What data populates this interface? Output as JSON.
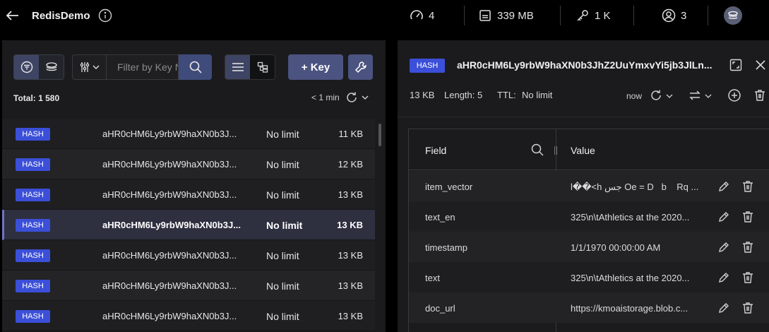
{
  "header": {
    "db_name": "RedisDemo",
    "stats": [
      {
        "icon": "gauge-icon",
        "value": "4"
      },
      {
        "icon": "memory-icon",
        "value": "339 MB"
      },
      {
        "icon": "key-icon",
        "value": "1 K"
      },
      {
        "icon": "user-icon",
        "value": "3"
      }
    ]
  },
  "browser": {
    "search_placeholder": "Filter by Key Name or Pattern",
    "add_key_label": "+ Key",
    "total": "Total: 1 580",
    "refresh_label": "< 1 min",
    "keys": [
      {
        "type": "HASH",
        "name": "aHR0cHM6Ly9rbW9haXN0b3J...",
        "ttl": "No limit",
        "size": "11 KB"
      },
      {
        "type": "HASH",
        "name": "aHR0cHM6Ly9rbW9haXN0b3J...",
        "ttl": "No limit",
        "size": "12 KB"
      },
      {
        "type": "HASH",
        "name": "aHR0cHM6Ly9rbW9haXN0b3J...",
        "ttl": "No limit",
        "size": "13 KB"
      },
      {
        "type": "HASH",
        "name": "aHR0cHM6Ly9rbW9haXN0b3J...",
        "ttl": "No limit",
        "size": "13 KB"
      },
      {
        "type": "HASH",
        "name": "aHR0cHM6Ly9rbW9haXN0b3J...",
        "ttl": "No limit",
        "size": "13 KB"
      },
      {
        "type": "HASH",
        "name": "aHR0cHM6Ly9rbW9haXN0b3J...",
        "ttl": "No limit",
        "size": "13 KB"
      },
      {
        "type": "HASH",
        "name": "aHR0cHM6Ly9rbW9haXN0b3J...",
        "ttl": "No limit",
        "size": "13 KB"
      }
    ]
  },
  "details": {
    "type": "HASH",
    "key_name": "aHR0cHM6Ly9rbW9haXN0b3JhZ2UuYmxvYi5jb3JlLn...",
    "size": "13 KB",
    "length": "Length: 5",
    "ttl_label": "TTL:",
    "ttl_value": "No limit",
    "refresh_label": "now",
    "columns": {
      "field": "Field",
      "value": "Value"
    },
    "rows": [
      {
        "field": "item_vector",
        "value": "l��<h جس Oe = D   b    Rq ..."
      },
      {
        "field": "text_en",
        "value": "325\\n\\tAthletics at the 2020..."
      },
      {
        "field": "timestamp",
        "value": "1/1/1970 00:00:00 AM"
      },
      {
        "field": "text",
        "value": "325\\n\\tAthletics at the 2020..."
      },
      {
        "field": "doc_url",
        "value": "https://kmoaistorage.blob.c..."
      }
    ]
  },
  "colors": {
    "accent": "#3b4fd8",
    "button": "#4b5380",
    "selected_row": "#2e3040"
  }
}
